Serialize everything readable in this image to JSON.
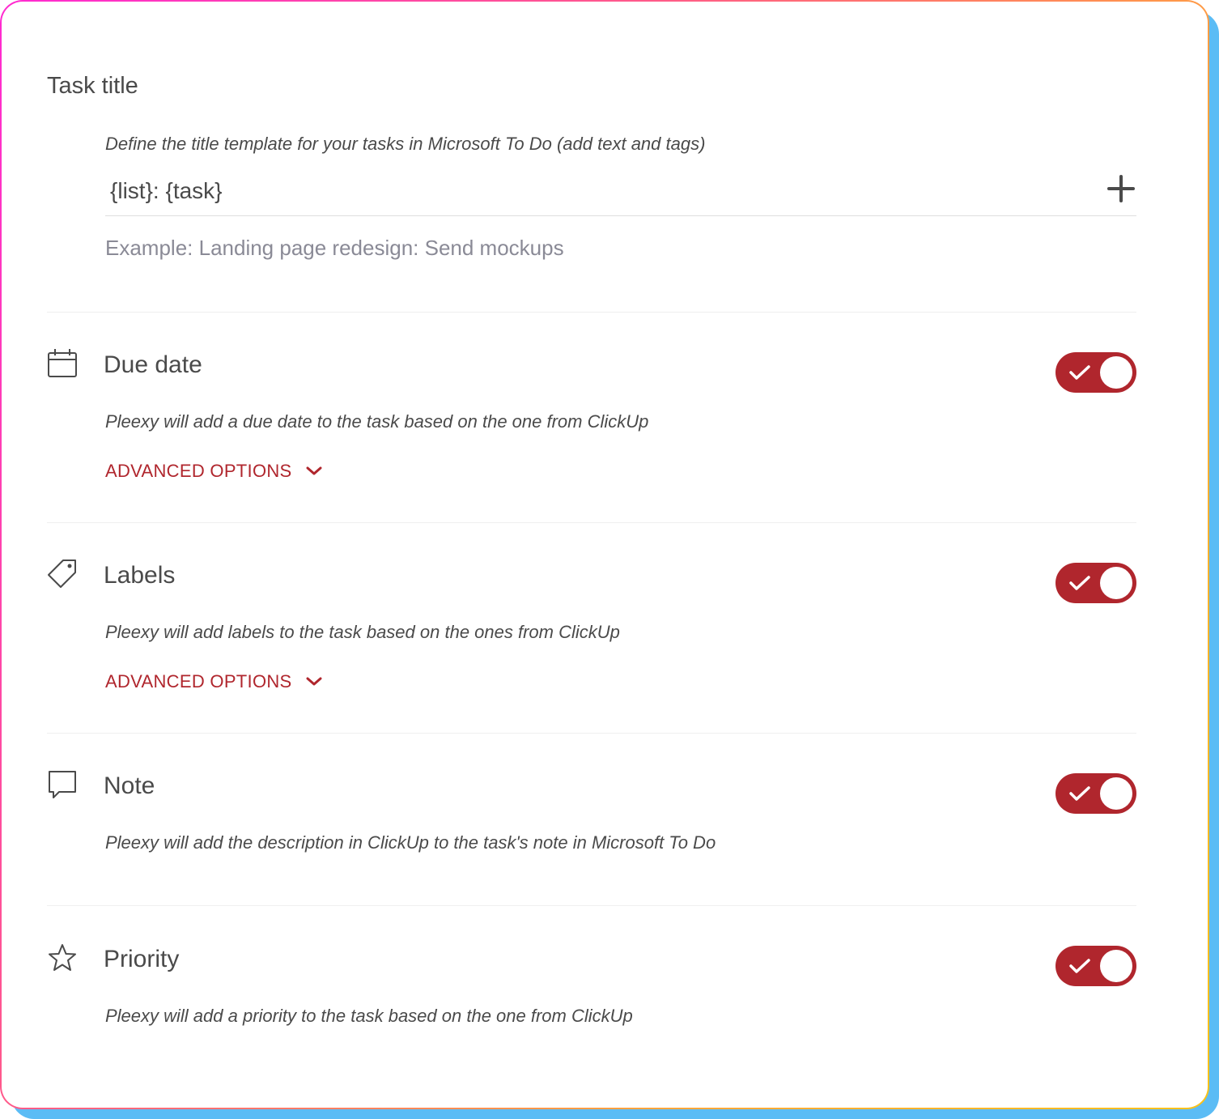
{
  "task_title": {
    "heading": "Task title",
    "description": "Define the title template for your tasks in Microsoft To Do (add text and tags)",
    "template_value": "{list}: {task}",
    "example": "Example: Landing page redesign: Send mockups"
  },
  "sections": [
    {
      "title": "Due date",
      "icon": "calendar-icon",
      "enabled": true,
      "description": "Pleexy will add a due date to the task based on the one from ClickUp",
      "advanced_label": "ADVANCED OPTIONS"
    },
    {
      "title": "Labels",
      "icon": "tag-icon",
      "enabled": true,
      "description": "Pleexy will add labels to the task based on the ones from ClickUp",
      "advanced_label": "ADVANCED OPTIONS"
    },
    {
      "title": "Note",
      "icon": "comment-icon",
      "enabled": true,
      "description": "Pleexy will add the description in ClickUp to the task's note in Microsoft To Do"
    },
    {
      "title": "Priority",
      "icon": "star-icon",
      "enabled": true,
      "description": "Pleexy will add a priority to the task based on the one from ClickUp"
    }
  ],
  "colors": {
    "accent": "#b0262d",
    "text": "#4a4a4a",
    "muted": "#8a8a96",
    "shadow": "#5bbcf5"
  }
}
